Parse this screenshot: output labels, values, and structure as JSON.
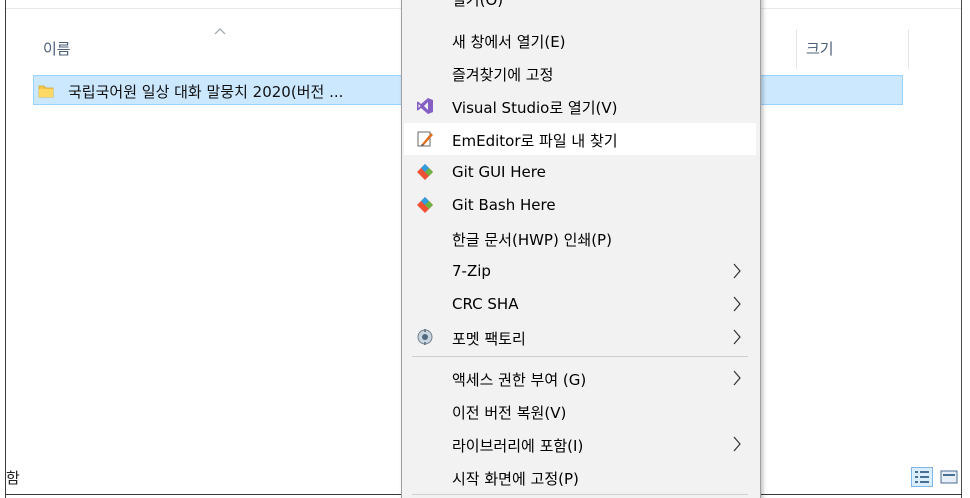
{
  "file_list": {
    "columns": {
      "name": "이름",
      "size": "크기"
    },
    "selected_item": {
      "name": "국립국어원 일상 대화 말뭉치 2020(버전 ..."
    }
  },
  "status_bar": {
    "partial_text": "함"
  },
  "context_menu": {
    "top_partial_label": "열기(O)",
    "items": [
      {
        "label": "새 창에서 열기(E)",
        "icon": "",
        "submenu": false
      },
      {
        "label": "즐겨찾기에 고정",
        "icon": "",
        "submenu": false
      },
      {
        "label": "Visual Studio로 열기(V)",
        "icon": "visual-studio-icon",
        "submenu": false
      },
      {
        "label": "EmEditor로 파일 내 찾기",
        "icon": "emeditor-icon",
        "submenu": false
      },
      {
        "label": "Git GUI Here",
        "icon": "git-icon",
        "submenu": false
      },
      {
        "label": "Git Bash Here",
        "icon": "git-icon",
        "submenu": false
      },
      {
        "label": "한글 문서(HWP) 인쇄(P)",
        "icon": "",
        "submenu": false
      },
      {
        "label": "7-Zip",
        "icon": "",
        "submenu": true
      },
      {
        "label": "CRC SHA",
        "icon": "",
        "submenu": true
      },
      {
        "label": "포멧 팩토리",
        "icon": "format-factory-icon",
        "submenu": true
      },
      {
        "label": "액세스 권한 부여 (G)",
        "icon": "",
        "submenu": true
      },
      {
        "label": "이전 버전 복원(V)",
        "icon": "",
        "submenu": false
      },
      {
        "label": "라이브러리에 포함(I)",
        "icon": "",
        "submenu": true
      },
      {
        "label": "시작 화면에 고정(P)",
        "icon": "",
        "submenu": false
      }
    ],
    "highlighted_index": 3
  },
  "colors": {
    "selection_bg": "#cce8ff",
    "selection_border": "#99d1ff",
    "menu_bg": "#f2f2f2",
    "header_text": "#4c607a"
  }
}
